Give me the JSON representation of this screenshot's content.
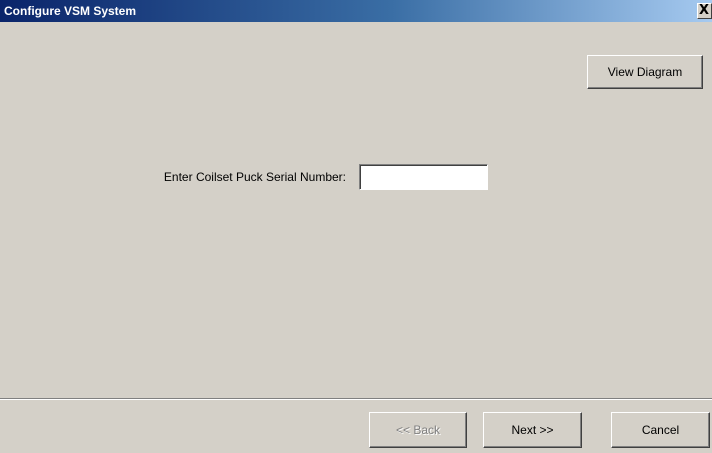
{
  "window": {
    "title": "Configure VSM System",
    "close_glyph": "X"
  },
  "toolbar": {
    "view_diagram_label": "View Diagram"
  },
  "form": {
    "serial_label": "Enter Coilset Puck Serial Number:",
    "serial_value": "",
    "serial_placeholder": ""
  },
  "footer": {
    "back_label": "<< Back",
    "back_enabled": false,
    "next_label": "Next >>",
    "cancel_label": "Cancel"
  },
  "colors": {
    "window_bg": "#d4d0c8",
    "titlebar_start": "#0a246a",
    "titlebar_end": "#a6caf0",
    "title_text": "#ffffff",
    "disabled_text": "#808080"
  },
  "icons": {
    "close": "close-icon"
  }
}
